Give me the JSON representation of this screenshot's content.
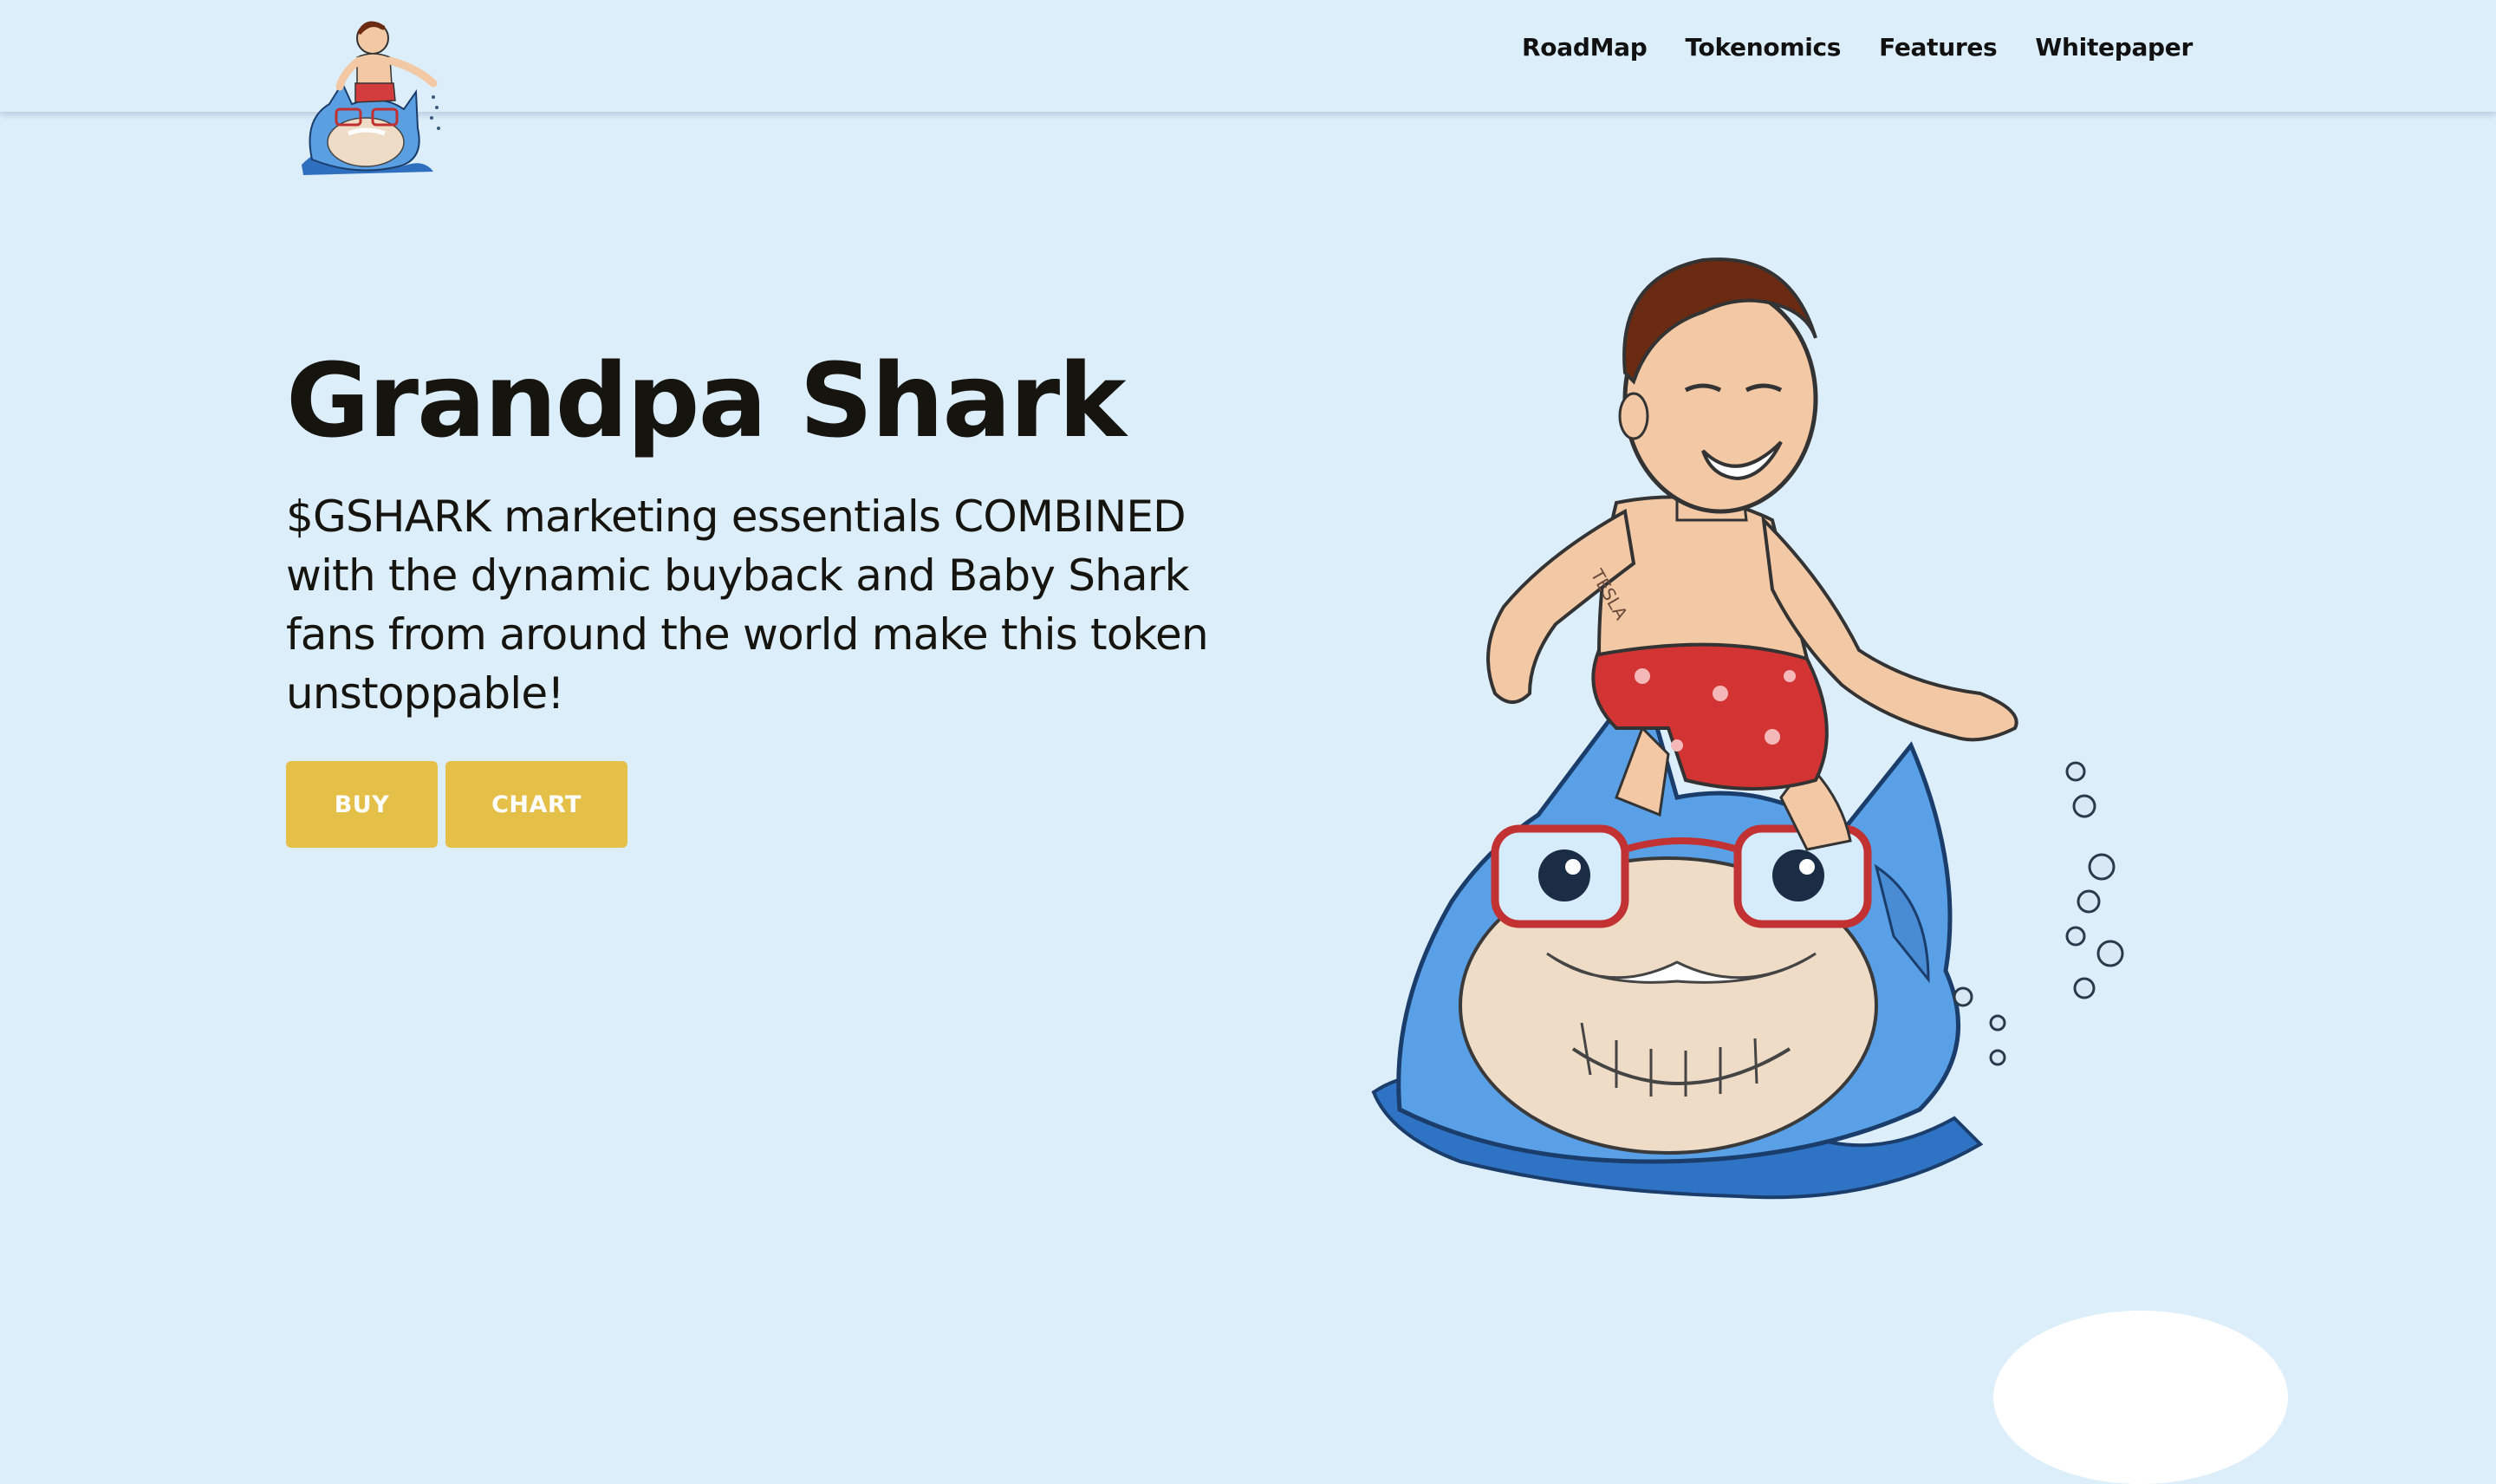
{
  "nav": {
    "links": [
      "RoadMap",
      "Tokenomics",
      "Features",
      "Whitepaper"
    ]
  },
  "hero": {
    "title": "Grandpa Shark",
    "description": "$GSHARK marketing essentials COMBINED with the dynamic buyback and Baby Shark fans from around the world make this token unstoppable!",
    "buy_label": "BUY",
    "chart_label": "CHART"
  },
  "mascot_tattoo": "TESLA",
  "colors": {
    "background": "#ddeefb",
    "button": "#e5c048",
    "button_text": "#ffffff",
    "text": "#15140f"
  }
}
